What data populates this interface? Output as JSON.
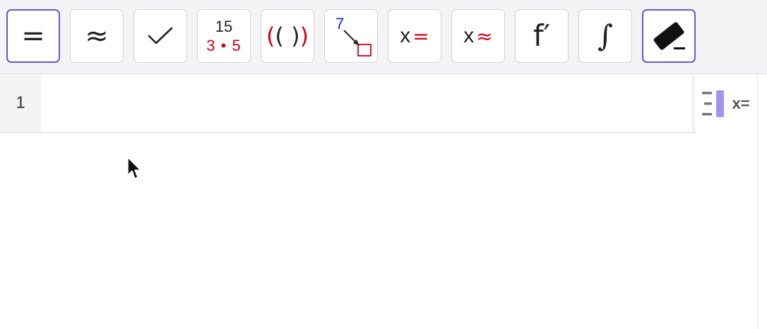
{
  "toolbar": {
    "tools": [
      {
        "name": "evaluate",
        "glyph": "="
      },
      {
        "name": "numeric",
        "glyph": "≈"
      },
      {
        "name": "keep-input",
        "glyph": "✓"
      },
      {
        "name": "factor",
        "numerator": "15",
        "denominator": "3 • 5"
      },
      {
        "name": "expand",
        "outer_left": "(",
        "inner": "( )",
        "outer_right": ")"
      },
      {
        "name": "substitute",
        "value": "7"
      },
      {
        "name": "solve",
        "var": "x",
        "op": "="
      },
      {
        "name": "solve-numeric",
        "var": "x",
        "op": "≈"
      },
      {
        "name": "derivative",
        "glyph": "f′"
      },
      {
        "name": "integral",
        "glyph": "∫"
      },
      {
        "name": "delete",
        "glyph": "eraser"
      }
    ],
    "colors": {
      "accent": "#6557d2",
      "red": "#d0021b",
      "blue": "#1d27c8"
    }
  },
  "input_row": {
    "number": "1",
    "value": ""
  },
  "panel_toggle": {
    "label": "x="
  }
}
